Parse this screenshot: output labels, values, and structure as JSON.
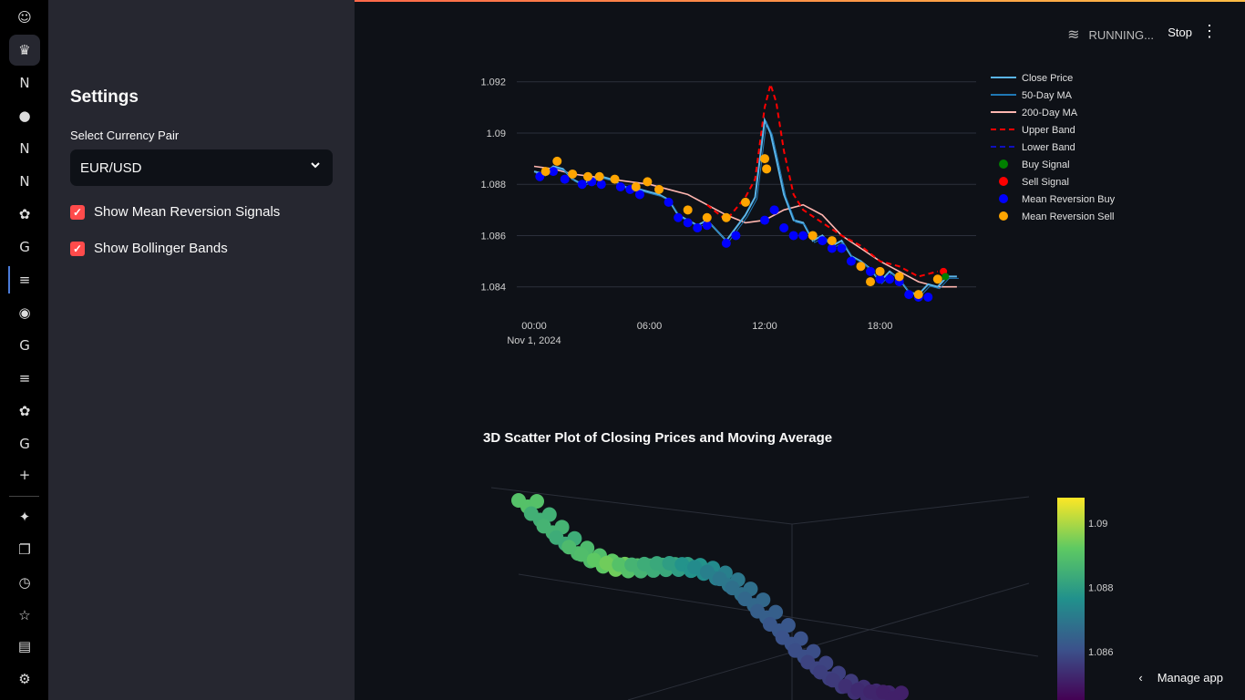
{
  "rail": {
    "icons": [
      {
        "name": "smiley-icon",
        "glyph": "☺"
      },
      {
        "name": "crown-icon",
        "glyph": "♛"
      },
      {
        "name": "notion-icon",
        "glyph": "N"
      },
      {
        "name": "reddit-icon",
        "glyph": "●"
      },
      {
        "name": "notion-icon",
        "glyph": "N"
      },
      {
        "name": "notion-icon",
        "glyph": "N"
      },
      {
        "name": "openai-icon",
        "glyph": "✿"
      },
      {
        "name": "google-icon",
        "glyph": "G"
      },
      {
        "name": "stackoverflow-icon",
        "glyph": "≡"
      },
      {
        "name": "github-icon",
        "glyph": "◉"
      },
      {
        "name": "google-icon",
        "glyph": "G"
      },
      {
        "name": "stackoverflow-icon",
        "glyph": "≡"
      },
      {
        "name": "openai-icon",
        "glyph": "✿"
      },
      {
        "name": "google-icon",
        "glyph": "G"
      },
      {
        "name": "plus-icon",
        "glyph": "+"
      },
      {
        "name": "sparkle-icon",
        "glyph": "✦"
      },
      {
        "name": "tabs-icon",
        "glyph": "❐"
      },
      {
        "name": "history-icon",
        "glyph": "◷"
      },
      {
        "name": "star-icon",
        "glyph": "☆"
      },
      {
        "name": "archive-icon",
        "glyph": "▤"
      },
      {
        "name": "settings-icon",
        "glyph": "⚙"
      }
    ]
  },
  "sidebar": {
    "title": "Settings",
    "select_label": "Select Currency Pair",
    "select_value": "EUR/USD",
    "checkbox_mean": "Show Mean Reversion Signals",
    "checkbox_bb": "Show Bollinger Bands",
    "checkbox_mark": "✓"
  },
  "header": {
    "status": "RUNNING...",
    "stop": "Stop",
    "menu_glyph": "⋮",
    "swim_glyph": "≋"
  },
  "chart_heading": "3D Scatter Plot of Closing Prices and Moving Average",
  "footer": {
    "manage": "Manage app",
    "arrow": "‹"
  },
  "chart_data": [
    {
      "type": "line",
      "title": "",
      "xlabel": "",
      "ylabel": "",
      "x_ticks": [
        "00:00",
        "06:00",
        "12:00",
        "18:00"
      ],
      "x_date_label": "Nov 1, 2024",
      "y_ticks": [
        1.084,
        1.086,
        1.088,
        1.09,
        1.092
      ],
      "ylim": [
        1.0831,
        1.0927
      ],
      "xlim_hours": [
        -0.9,
        23.0
      ],
      "grid": true,
      "legend_position": "right",
      "colors": {
        "close": "#5ab4e8",
        "ma50": "#1f77b4",
        "ma200": "#ffb6b0",
        "upper": "#ff0000",
        "lower": "#1010c0",
        "buy": "#008000",
        "sell": "#ff0000",
        "mr_buy": "#0000ff",
        "mr_sell": "#ffa500"
      },
      "legend": [
        {
          "name": "Close Price",
          "style": "line",
          "color": "#5ab4e8"
        },
        {
          "name": "50-Day MA",
          "style": "line",
          "color": "#1f77b4"
        },
        {
          "name": "200-Day MA",
          "style": "line",
          "color": "#ffb6b0"
        },
        {
          "name": "Upper Band",
          "style": "dash",
          "color": "#ff0000"
        },
        {
          "name": "Lower Band",
          "style": "dash",
          "color": "#1010c0"
        },
        {
          "name": "Buy Signal",
          "style": "dot",
          "color": "#008000"
        },
        {
          "name": "Sell Signal",
          "style": "dot",
          "color": "#ff0000"
        },
        {
          "name": "Mean Reversion Buy",
          "style": "dot",
          "color": "#0000ff"
        },
        {
          "name": "Mean Reversion Sell",
          "style": "dot",
          "color": "#ffa500"
        }
      ],
      "series": [
        {
          "name": "Close Price",
          "x": [
            0,
            0.5,
            1,
            1.5,
            2,
            2.5,
            3,
            3.5,
            4,
            4.5,
            5,
            5.5,
            6,
            6.5,
            7,
            7.5,
            8,
            8.5,
            9,
            9.5,
            10,
            10.5,
            11,
            11.5,
            12,
            12.3,
            12.6,
            13,
            13.5,
            14,
            14.5,
            15,
            15.5,
            16,
            16.5,
            17,
            17.5,
            18,
            18.5,
            19,
            19.5,
            20,
            20.5,
            21,
            21.5,
            22
          ],
          "y": [
            1.0885,
            1.0884,
            1.0887,
            1.0886,
            1.0882,
            1.088,
            1.0882,
            1.0883,
            1.0882,
            1.088,
            1.0878,
            1.0878,
            1.0877,
            1.0876,
            1.0874,
            1.0868,
            1.0866,
            1.0864,
            1.0866,
            1.0862,
            1.0858,
            1.0863,
            1.0868,
            1.0875,
            1.0905,
            1.09,
            1.089,
            1.0876,
            1.0866,
            1.0865,
            1.0858,
            1.086,
            1.0856,
            1.0858,
            1.0852,
            1.085,
            1.0847,
            1.0842,
            1.0846,
            1.0843,
            1.0838,
            1.0837,
            1.0841,
            1.084,
            1.0844,
            1.0844
          ]
        },
        {
          "name": "200-Day MA",
          "x": [
            0,
            1,
            2,
            3,
            4,
            5,
            6,
            7,
            8,
            9,
            10,
            11,
            12,
            13,
            14,
            15,
            16,
            17,
            18,
            19,
            20,
            21,
            22
          ],
          "y": [
            1.0887,
            1.0886,
            1.0884,
            1.0883,
            1.0882,
            1.0881,
            1.088,
            1.0878,
            1.0876,
            1.0872,
            1.0868,
            1.0865,
            1.0866,
            1.087,
            1.0872,
            1.0868,
            1.086,
            1.0855,
            1.085,
            1.0846,
            1.0842,
            1.084,
            1.084
          ]
        },
        {
          "name": "Upper Band",
          "x": [
            9,
            10,
            11,
            11.5,
            12,
            12.3,
            12.6,
            13,
            13.5,
            14,
            15,
            16,
            17,
            18,
            19,
            20,
            21
          ],
          "y": [
            1.0872,
            1.0866,
            1.0875,
            1.0882,
            1.091,
            1.0919,
            1.0912,
            1.0893,
            1.0876,
            1.087,
            1.0865,
            1.086,
            1.0856,
            1.085,
            1.0848,
            1.0844,
            1.0846
          ]
        }
      ],
      "mean_reversion_buy": [
        [
          0.3,
          1.0883
        ],
        [
          1,
          1.0885
        ],
        [
          1.6,
          1.0882
        ],
        [
          2.5,
          1.088
        ],
        [
          3,
          1.0881
        ],
        [
          3.5,
          1.088
        ],
        [
          4.5,
          1.0879
        ],
        [
          5,
          1.0878
        ],
        [
          5.5,
          1.0876
        ],
        [
          7,
          1.0873
        ],
        [
          7.5,
          1.0867
        ],
        [
          8,
          1.0865
        ],
        [
          8.5,
          1.0863
        ],
        [
          9,
          1.0864
        ],
        [
          10,
          1.0857
        ],
        [
          10.5,
          1.086
        ],
        [
          12,
          1.0866
        ],
        [
          12.5,
          1.087
        ],
        [
          13,
          1.0863
        ],
        [
          13.5,
          1.086
        ],
        [
          14,
          1.086
        ],
        [
          15,
          1.0858
        ],
        [
          15.5,
          1.0855
        ],
        [
          16,
          1.0855
        ],
        [
          16.5,
          1.085
        ],
        [
          17,
          1.0848
        ],
        [
          17.5,
          1.0846
        ],
        [
          18,
          1.0843
        ],
        [
          18.5,
          1.0843
        ],
        [
          19,
          1.0842
        ],
        [
          19.5,
          1.0837
        ],
        [
          20,
          1.0836
        ],
        [
          20.5,
          1.0836
        ]
      ],
      "mean_reversion_sell": [
        [
          0.6,
          1.0885
        ],
        [
          1.2,
          1.0889
        ],
        [
          2,
          1.0884
        ],
        [
          2.8,
          1.0883
        ],
        [
          3.4,
          1.0883
        ],
        [
          4.2,
          1.0882
        ],
        [
          5.3,
          1.0879
        ],
        [
          5.9,
          1.0881
        ],
        [
          6.5,
          1.0878
        ],
        [
          8,
          1.087
        ],
        [
          9,
          1.0867
        ],
        [
          10,
          1.0867
        ],
        [
          11,
          1.0873
        ],
        [
          12,
          1.089
        ],
        [
          12.1,
          1.0886
        ],
        [
          14.5,
          1.086
        ],
        [
          15.5,
          1.0858
        ],
        [
          17,
          1.0848
        ],
        [
          17.5,
          1.0842
        ],
        [
          18,
          1.0846
        ],
        [
          19,
          1.0844
        ],
        [
          20,
          1.0837
        ],
        [
          21,
          1.0843
        ]
      ],
      "buy_signal": [
        [
          21.4,
          1.0844
        ]
      ],
      "sell_signal": [
        [
          21.3,
          1.0846
        ]
      ]
    },
    {
      "type": "scatter",
      "title": "3D Scatter Plot of Closing Prices and Moving Average",
      "colorbar_ticks": [
        1.086,
        1.088,
        1.09
      ],
      "colorscale": "Viridis",
      "clim": [
        1.0845,
        1.0908
      ],
      "values": [
        1.089,
        1.0885,
        1.0886,
        1.0884,
        1.0888,
        1.0889,
        1.0892,
        1.0894,
        1.089,
        1.0886,
        1.0884,
        1.0883,
        1.088,
        1.0877,
        1.0875,
        1.0872,
        1.087,
        1.0868,
        1.0866,
        1.0864,
        1.0862,
        1.0861,
        1.086,
        1.0858,
        1.0857,
        1.0856,
        1.0854,
        1.0853,
        1.0852,
        1.0851
      ]
    }
  ]
}
